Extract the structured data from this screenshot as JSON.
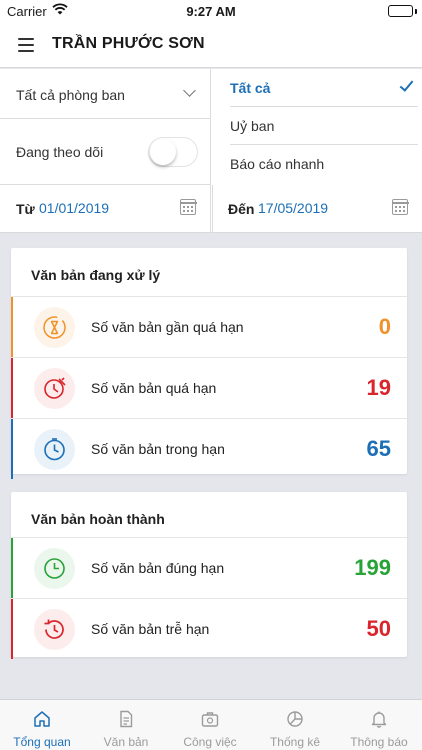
{
  "status_bar": {
    "carrier": "Carrier",
    "time": "9:27 AM"
  },
  "header": {
    "title": "TRẦN PHƯỚC SƠN"
  },
  "filters": {
    "department": "Tất cả phòng ban",
    "following_label": "Đang theo dõi",
    "following_on": false,
    "scope_options": [
      "Tất cả",
      "Uỷ ban",
      "Báo cáo nhanh"
    ],
    "selected_scope": "Tất cả",
    "from_label": "Từ",
    "from_date": "01/01/2019",
    "to_label": "Đến",
    "to_date": "17/05/2019"
  },
  "processing": {
    "title": "Văn bản đang xử lý",
    "rows": [
      {
        "label": "Số văn bản gần quá hạn",
        "count": "0",
        "color": "#f0922b",
        "icon": "hourglass-icon"
      },
      {
        "label": "Số văn bản quá hạn",
        "count": "19",
        "color": "#d9252b",
        "icon": "alarm-clock-icon"
      },
      {
        "label": "Số văn bản trong hạn",
        "count": "65",
        "color": "#1c6fb6",
        "icon": "clock-icon"
      }
    ]
  },
  "completed": {
    "title": "Văn bản hoàn thành",
    "rows": [
      {
        "label": "Số văn bản đúng hạn",
        "count": "199",
        "color": "#27a338",
        "icon": "timer-icon"
      },
      {
        "label": "Số văn bản trễ hạn",
        "count": "50",
        "color": "#d9252b",
        "icon": "history-icon"
      }
    ]
  },
  "tabs": [
    {
      "label": "Tổng quan",
      "icon": "home-icon",
      "active": true
    },
    {
      "label": "Văn bản",
      "icon": "document-icon",
      "active": false
    },
    {
      "label": "Công việc",
      "icon": "briefcase-icon",
      "active": false
    },
    {
      "label": "Thống kê",
      "icon": "pie-chart-icon",
      "active": false
    },
    {
      "label": "Thông báo",
      "icon": "bell-icon",
      "active": false
    }
  ]
}
